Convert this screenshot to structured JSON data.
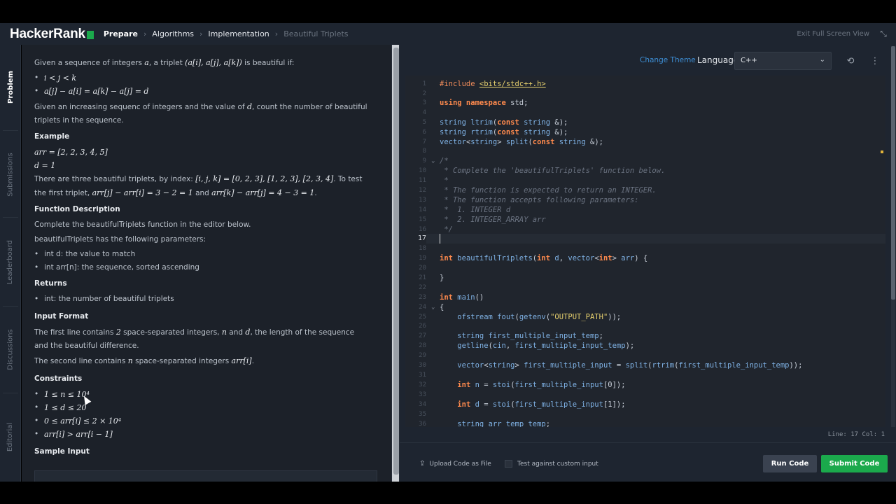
{
  "header": {
    "logo": "HackerRank",
    "breadcrumbs": [
      "Prepare",
      "Algorithms",
      "Implementation",
      "Beautiful Triplets"
    ],
    "exit_fullscreen": "Exit Full Screen View"
  },
  "side_tabs": [
    "Problem",
    "Submissions",
    "Leaderboard",
    "Discussions",
    "Editorial"
  ],
  "problem": {
    "intro_a": "Given a sequence of integers",
    "intro_var": "a",
    "intro_b": ", a triplet",
    "intro_triplet": "(a[i], a[j], a[k])",
    "intro_c": "is beautiful if:",
    "cond1": "i < j < k",
    "cond2": "a[j] − a[i] = a[k] − a[j] = d",
    "given_a": "Given an increasing sequenc of integers and the value of",
    "given_var": "d",
    "given_b": ", count the number of beautiful triplets in the sequence.",
    "example_heading": "Example",
    "example_arr": "arr = [2, 2, 3, 4, 5]",
    "example_d": "d = 1",
    "explain_a": "There are three beautiful triplets, by index:",
    "explain_idx": "[i, j, k] = [0, 2, 3], [1, 2, 3], [2, 3, 4]",
    "explain_b": ". To test the first triplet,",
    "explain_calc1": "arr[j] − arr[i] = 3 − 2 = 1",
    "explain_and": "and",
    "explain_calc2": "arr[k] − arr[j] = 4 − 3 = 1",
    "explain_end": ".",
    "func_heading": "Function Description",
    "func_text": "Complete the beautifulTriplets function in the editor below.",
    "params_text": "beautifulTriplets has the following parameters:",
    "param1": "int d: the value to match",
    "param2": "int arr[n]: the sequence, sorted ascending",
    "returns_heading": "Returns",
    "returns1": "int: the number of beautiful triplets",
    "input_heading": "Input Format",
    "input1_a": "The first line contains",
    "input1_num": "2",
    "input1_b": "space-separated integers,",
    "input1_n": "n",
    "input1_and": "and",
    "input1_d": "d",
    "input1_c": ", the length of the sequence and the beautiful difference.",
    "input2_a": "The second line contains",
    "input2_n": "n",
    "input2_b": "space-separated integers",
    "input2_var": "arr[i]",
    "input2_end": ".",
    "constraints_heading": "Constraints",
    "con1": "1 ≤ n ≤ 10⁴",
    "con2": "1 ≤ d ≤ 20",
    "con3": "0 ≤ arr[i] ≤ 2 × 10⁴",
    "con4": "arr[i] > arr[i − 1]",
    "sample_heading": "Sample Input"
  },
  "editor": {
    "change_theme": "Change Theme",
    "language_label": "Language",
    "language_value": "C++",
    "status": "Line: 17 Col: 1",
    "upload": "Upload Code as File",
    "custom_input": "Test against custom input",
    "run": "Run Code",
    "submit": "Submit Code"
  },
  "colors": {
    "brand_green": "#1ba94c",
    "link_blue": "#3d8fd6",
    "keyword": "#ff8a4d",
    "type": "#7fb2e5",
    "string": "#e6d06e"
  }
}
